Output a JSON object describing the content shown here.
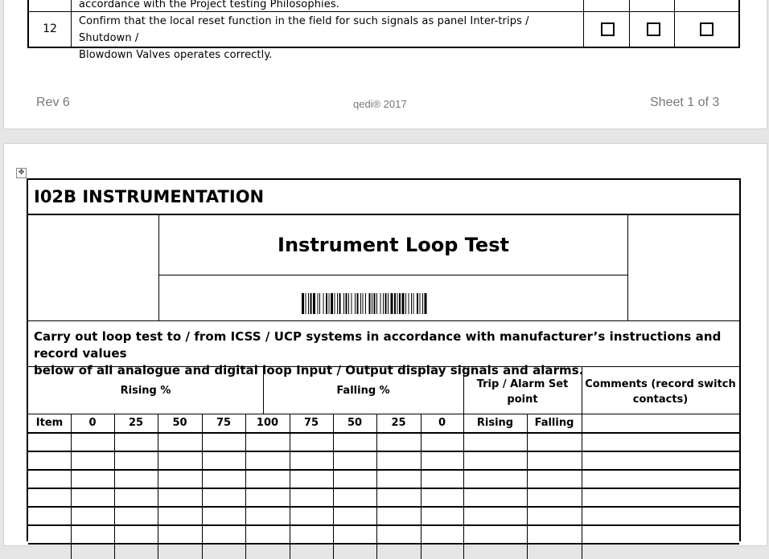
{
  "previous_page": {
    "row_above_text": "accordance with the Project testing Philosophies.",
    "row": {
      "number": "12",
      "text_line1": "Confirm that the local reset function in the field for such signals as panel Inter-trips / Shutdown /",
      "text_line2": "Blowdown Valves operates correctly."
    },
    "footer": {
      "rev": "Rev 6",
      "copyright": "qedi® 2017",
      "sheet": "Sheet 1 of 3"
    }
  },
  "form": {
    "section_title": "I02B INSTRUMENTATION",
    "form_title": "Instrument Loop Test",
    "instructions_line1": "Carry out loop test to / from ICSS / UCP systems in accordance with manufacturer’s instructions and record values",
    "instructions_line2": "below of all analogue and digital loop Input / Output display signals and alarms.",
    "group_headers": {
      "rising": "Rising %",
      "falling": "Falling %",
      "trip_line1": "Trip / Alarm Set",
      "trip_line2": "point",
      "comments_line1": "Comments (record switch",
      "comments_line2": "contacts)"
    },
    "column_headers": [
      "Item",
      "0",
      "25",
      "50",
      "75",
      "100",
      "75",
      "50",
      "25",
      "0",
      "Rising",
      "Falling",
      ""
    ],
    "empty_rows": 6
  }
}
